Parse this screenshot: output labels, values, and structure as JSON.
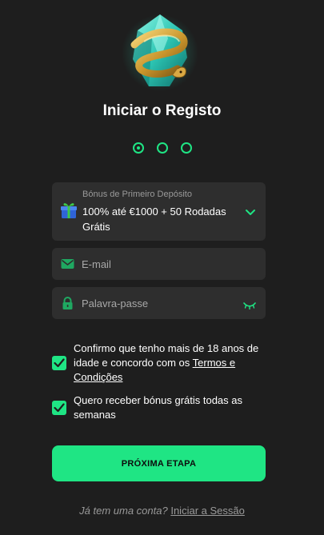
{
  "page": {
    "title": "Iniciar o Registo"
  },
  "steps": [
    {
      "state": "active"
    },
    {
      "state": "inactive"
    },
    {
      "state": "inactive"
    }
  ],
  "bonus": {
    "caption": "Bónus de Primeiro Depósito",
    "value": "100% até €1000 + 50 Rodadas Grátis",
    "icon": "gift-icon"
  },
  "email": {
    "placeholder": "E-mail",
    "value": "",
    "icon": "envelope-icon"
  },
  "password": {
    "placeholder": "Palavra-passe",
    "value": "",
    "icon": "lock-icon"
  },
  "consent": {
    "text": "Confirmo que tenho mais de 18 anos de idade e concordo com os ",
    "link": "Termos e Condições",
    "checked": true
  },
  "newsletter": {
    "text": "Quero receber bónus grátis todas as semanas",
    "checked": true
  },
  "next_button": {
    "label": "PRÓXIMA ETAPA"
  },
  "login": {
    "prompt": "Já tem uma conta?",
    "link": "Iniciar a Sessão"
  },
  "colors": {
    "accent": "#1fe584",
    "background": "#1e1e1e",
    "field": "#2e2e2e"
  }
}
